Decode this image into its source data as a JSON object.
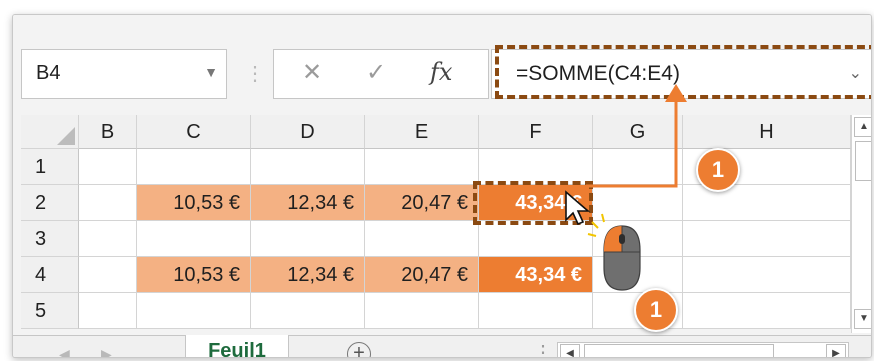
{
  "name_box": {
    "value": "B4"
  },
  "formula_bar": {
    "cancel_glyph": "✕",
    "enter_glyph": "✓",
    "fx_label": "fx",
    "formula": "=SOMME(C4:E4)"
  },
  "columns": [
    "B",
    "C",
    "D",
    "E",
    "F",
    "G",
    "H"
  ],
  "rows": [
    "1",
    "2",
    "3",
    "4",
    "5"
  ],
  "cells": {
    "row2": {
      "C": "10,53 €",
      "D": "12,34 €",
      "E": "20,47 €",
      "F": "43,34 €"
    },
    "row4": {
      "C": "10,53 €",
      "D": "12,34 €",
      "E": "20,47 €",
      "F": "43,34 €"
    }
  },
  "sheet_tabs": [
    {
      "label": "Feuil1",
      "active": true
    }
  ],
  "annotations": {
    "badge1": "1",
    "badge2": "1"
  },
  "colors": {
    "accent_dark": "#ed7d31",
    "accent_light": "#f4b183",
    "dash": "#8b4a12",
    "sheet_tab_text": "#1e6b3d"
  },
  "icons": [
    "dropdown-chevron-icon",
    "cancel-icon",
    "enter-check-icon",
    "fx-icon",
    "add-sheet-icon",
    "scroll-up-icon",
    "scroll-down-icon",
    "scroll-left-icon",
    "scroll-right-icon",
    "mouse-pointer-icon",
    "mouse-icon"
  ]
}
